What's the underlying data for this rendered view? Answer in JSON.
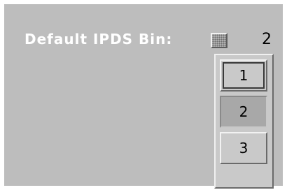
{
  "field": {
    "label": "Default IPDS Bin:",
    "current_value": "2"
  },
  "option_button": {
    "icon": "dotted-option-menu-icon"
  },
  "menu": {
    "options": [
      "1",
      "2",
      "3"
    ],
    "selected": "2",
    "focused": "1"
  }
}
